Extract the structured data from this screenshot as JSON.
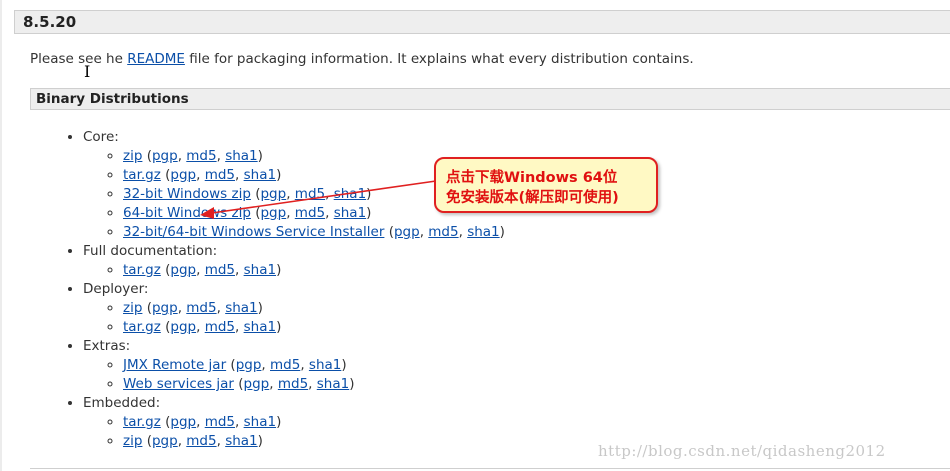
{
  "version": {
    "title": "8.5.20"
  },
  "intro": {
    "prefix": "Please see ",
    "cursor_char": "I",
    "partial": "he ",
    "readme_link": "README",
    "suffix": " file for packaging information. It explains what every distribution contains."
  },
  "binary": {
    "title": "Binary Distributions",
    "sig": {
      "pgp": "pgp",
      "md5": "md5",
      "sha1": "sha1"
    },
    "groups": [
      {
        "label": "Core:",
        "items": [
          "zip",
          "tar.gz",
          "32-bit Windows zip",
          "64-bit Windows zip",
          "32-bit/64-bit Windows Service Installer"
        ]
      },
      {
        "label": "Full documentation:",
        "items": [
          "tar.gz"
        ]
      },
      {
        "label": "Deployer:",
        "items": [
          "zip",
          "tar.gz"
        ]
      },
      {
        "label": "Extras:",
        "items": [
          "JMX Remote jar",
          "Web services jar"
        ]
      },
      {
        "label": "Embedded:",
        "items": [
          "tar.gz",
          "zip"
        ]
      }
    ]
  },
  "callout": {
    "line1": "点击下载Windows 64位",
    "line2": "免安装版本(解压即可使用)",
    "border_color": "#e02020",
    "bg_color": "#fff9c4"
  },
  "watermark": "http://blog.csdn.net/qidasheng2012",
  "colors": {
    "link": "#0b4fa8",
    "header_bg": "#eeeeee"
  }
}
